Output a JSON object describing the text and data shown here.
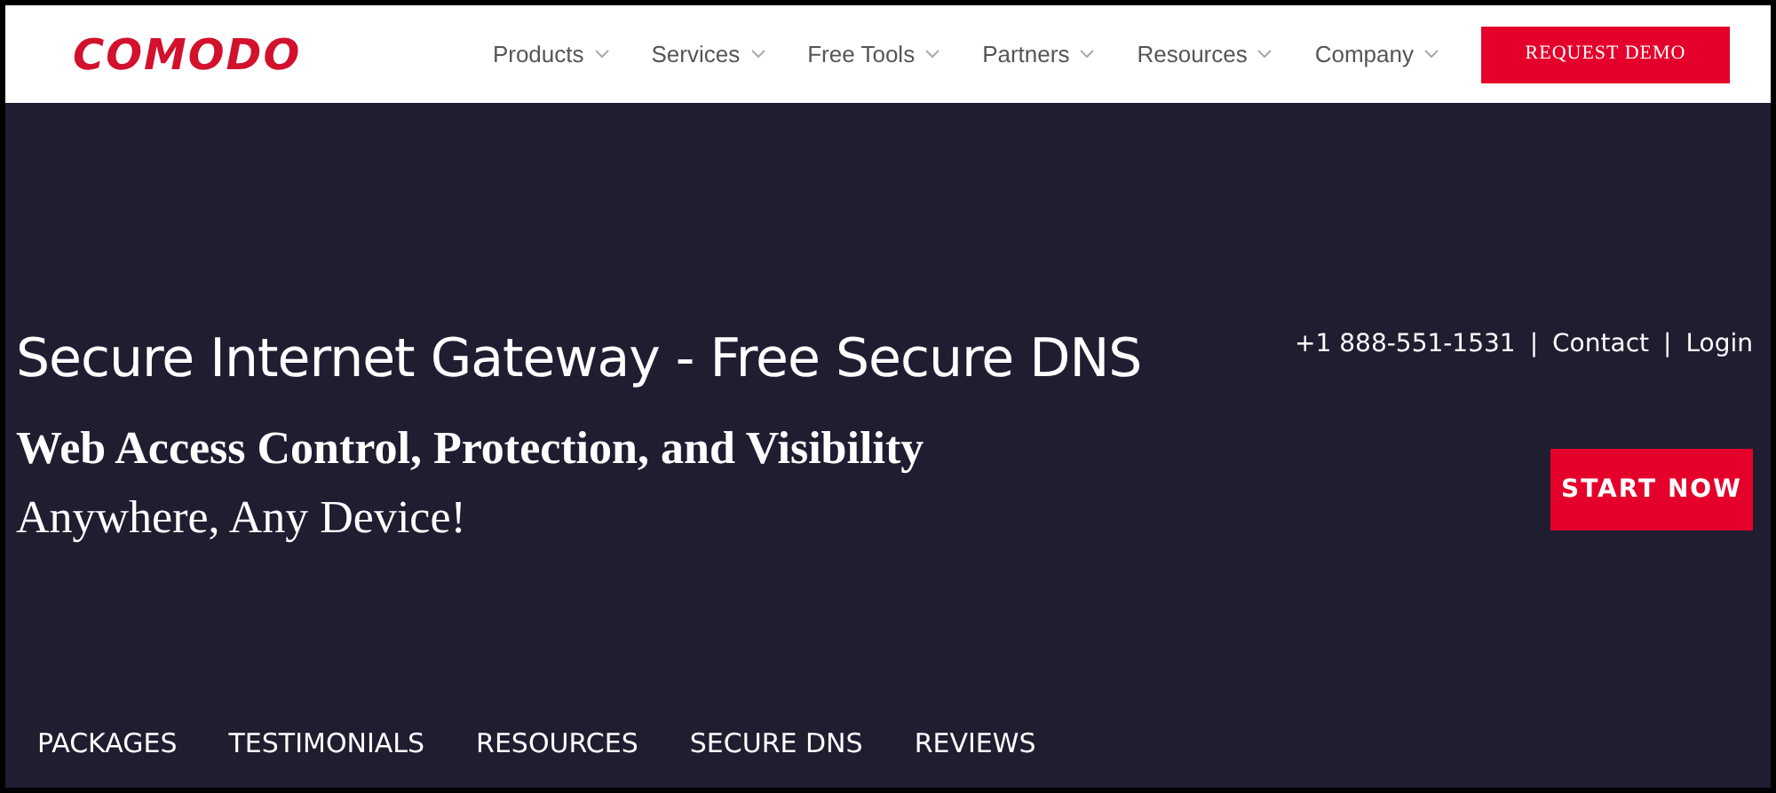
{
  "header": {
    "logo": "COMODO",
    "menu": [
      {
        "label": "Products"
      },
      {
        "label": "Services"
      },
      {
        "label": "Free Tools"
      },
      {
        "label": "Partners"
      },
      {
        "label": "Resources"
      },
      {
        "label": "Company"
      }
    ],
    "cta": "REQUEST DEMO"
  },
  "hero": {
    "title": "Secure Internet Gateway - Free Secure DNS",
    "subtitle": "Web Access Control, Protection, and Visibility",
    "tagline": "Anywhere, Any Device!",
    "phone": "+1 888-551-1531",
    "links": [
      {
        "separator": "|",
        "label": "Contact"
      },
      {
        "separator": "|",
        "label": "Login"
      }
    ],
    "button": "START NOW"
  },
  "subnav": [
    {
      "label": "PACKAGES"
    },
    {
      "label": "TESTIMONIALS"
    },
    {
      "label": "RESOURCES"
    },
    {
      "label": "SECURE DNS"
    },
    {
      "label": "REVIEWS"
    }
  ]
}
